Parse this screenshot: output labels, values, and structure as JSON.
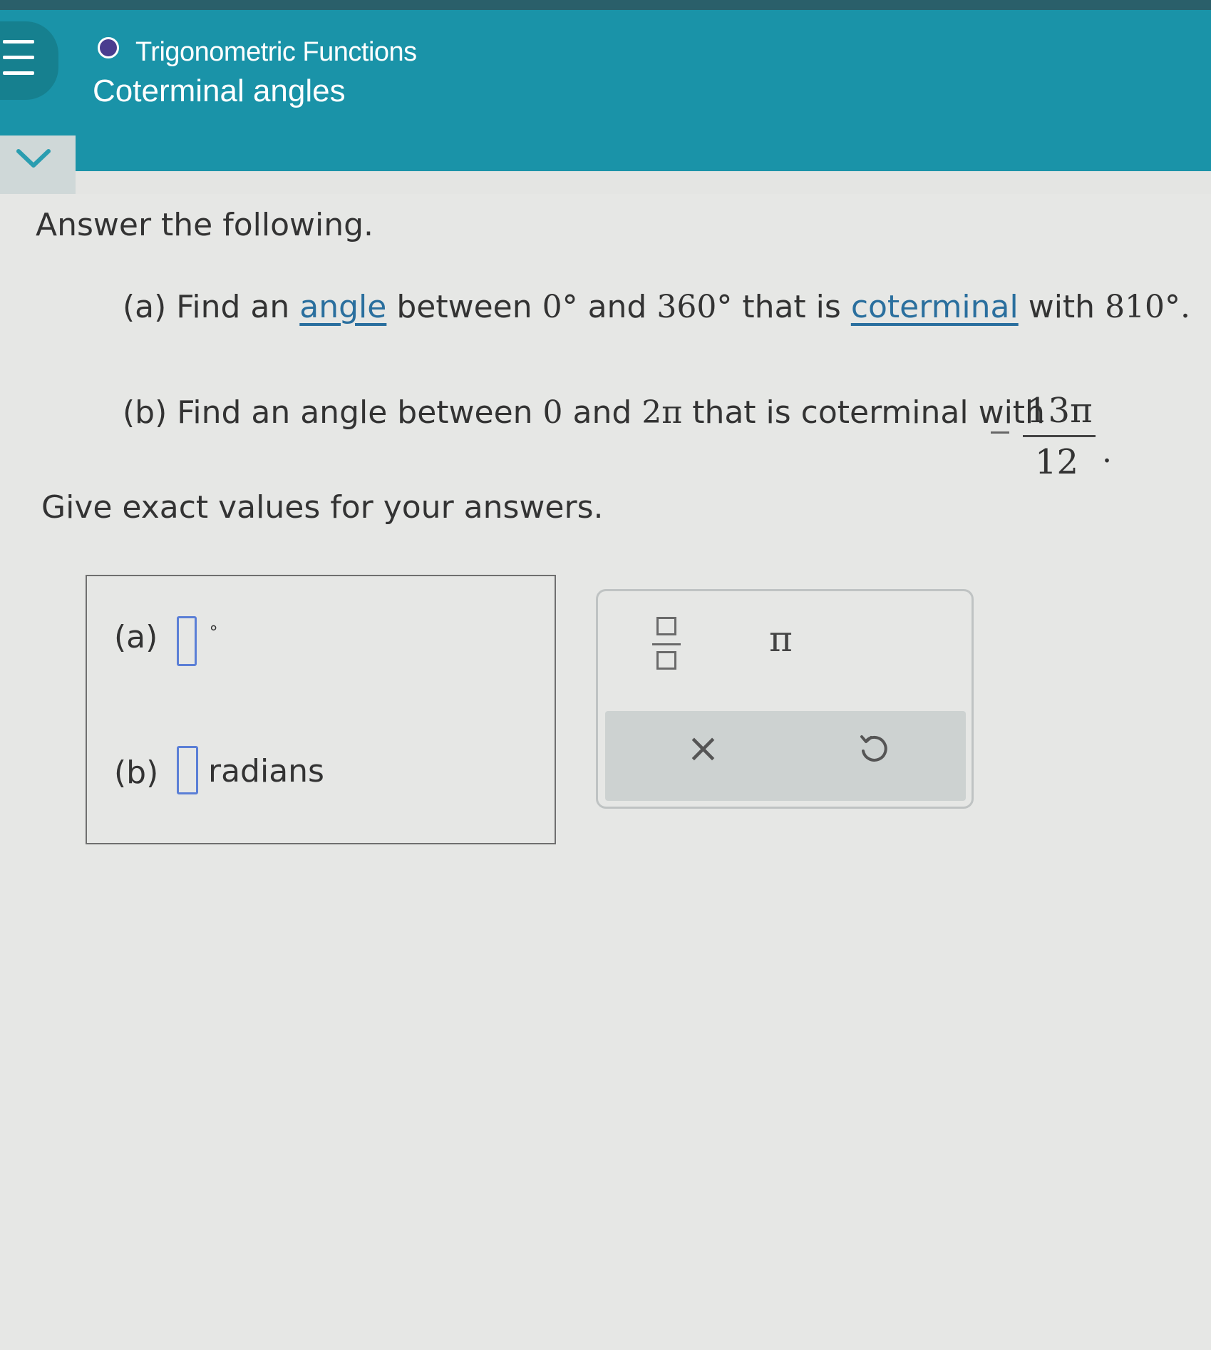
{
  "header": {
    "topic": "Trigonometric Functions",
    "title": "Coterminal angles",
    "menu_icon": "hamburger-menu-icon",
    "status_dot_color": "#4a3d8f"
  },
  "collapse_icon": "chevron-down-icon",
  "problem": {
    "lead": "Answer the following.",
    "part_a": {
      "prefix": "(a) Find an ",
      "link1": "angle",
      "mid1": " between ",
      "v1": "0°",
      "mid2": " and ",
      "v2": "360°",
      "mid3": " that is ",
      "link2": "coterminal",
      "mid4": " with ",
      "v3": "810°."
    },
    "part_b": {
      "prefix": "(b) Find an angle between ",
      "v1": "0",
      "mid1": " and ",
      "v2": "2π",
      "mid2": " that is coterminal with",
      "numerator": "13π",
      "denominator": "12",
      "period": "."
    },
    "instruction": "Give exact values for your answers."
  },
  "answers": {
    "a_label": "(a)",
    "a_unit": "∘",
    "b_label": "(b)",
    "b_unit": "radians"
  },
  "keypad": {
    "fraction_icon": "fraction-icon",
    "pi": "π",
    "clear": "×",
    "undo_icon": "undo-icon"
  },
  "colors": {
    "header": "#1a93a8",
    "link": "#2a6f9e",
    "input_border": "#5b7fd6"
  }
}
